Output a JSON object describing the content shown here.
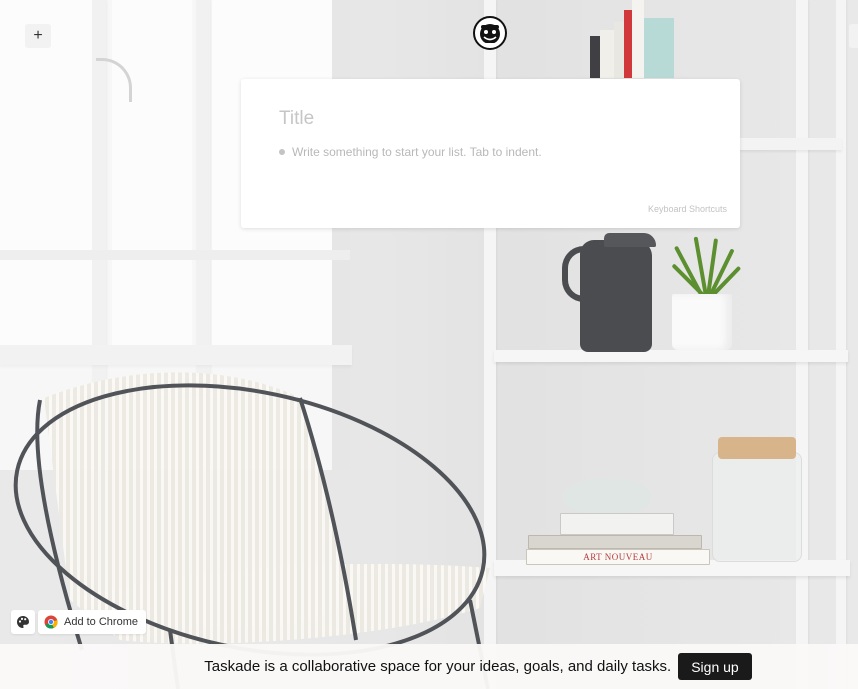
{
  "toolbar": {
    "add_label": "+",
    "add_icon": "plus-icon",
    "logo_icon": "taskade-logo"
  },
  "editor": {
    "title_placeholder": "Title",
    "item_placeholder": "Write something to start your list. Tab to indent.",
    "shortcuts_label": "Keyboard Shortcuts"
  },
  "bottom_tools": {
    "theme_icon": "palette-icon",
    "chrome_icon": "chrome-icon",
    "chrome_label": "Add to Chrome"
  },
  "footer": {
    "tagline": "Taskade is a collaborative space for your ideas, goals, and daily tasks.",
    "signup_label": "Sign up"
  },
  "background": {
    "subject": "room-photo",
    "book_label": "ART NOUVEAU"
  },
  "colors": {
    "footer_button": "#1a1a1a",
    "card_background": "#ffffff"
  }
}
